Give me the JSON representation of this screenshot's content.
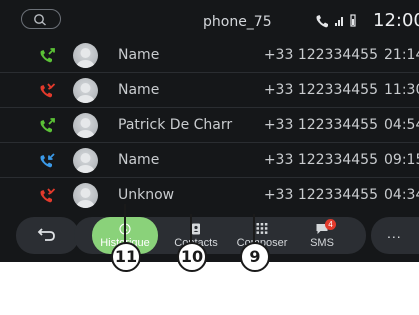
{
  "status_bar": {
    "phone_name": "phone_75",
    "clock": "12:00",
    "icons": [
      "search-icon",
      "phone-icon",
      "signal-icon",
      "battery-icon"
    ]
  },
  "calls": [
    {
      "type": "outgoing",
      "color": "#5bc236",
      "name": "Name",
      "number": "+33 122334455",
      "time": "21:14"
    },
    {
      "type": "missed",
      "color": "#e23a2c",
      "name": "Name",
      "number": "+33 122334455",
      "time": "11:30"
    },
    {
      "type": "outgoing",
      "color": "#5bc236",
      "name": "Patrick De Charr",
      "number": "+33 122334455",
      "time": "04:54"
    },
    {
      "type": "incoming",
      "color": "#3b9ae8",
      "name": "Name",
      "number": "+33 122334455",
      "time": "09:15"
    },
    {
      "type": "missed",
      "color": "#e23a2c",
      "name": "Unknow",
      "number": "+33 122334455",
      "time": "04:34"
    }
  ],
  "tabs": [
    {
      "label": "Historique",
      "icon": "clock-icon",
      "active": true
    },
    {
      "label": "Contacts",
      "icon": "contacts-book-icon",
      "active": false
    },
    {
      "label": "Composer",
      "icon": "dialpad-icon",
      "active": false
    },
    {
      "label": "SMS",
      "icon": "sms-icon",
      "active": false,
      "badge": "4"
    }
  ],
  "more_label": "...",
  "callouts": [
    "11",
    "10",
    "9"
  ],
  "colors": {
    "accent": "#8ad27a",
    "background": "#151719",
    "surface": "#2b2e33"
  }
}
